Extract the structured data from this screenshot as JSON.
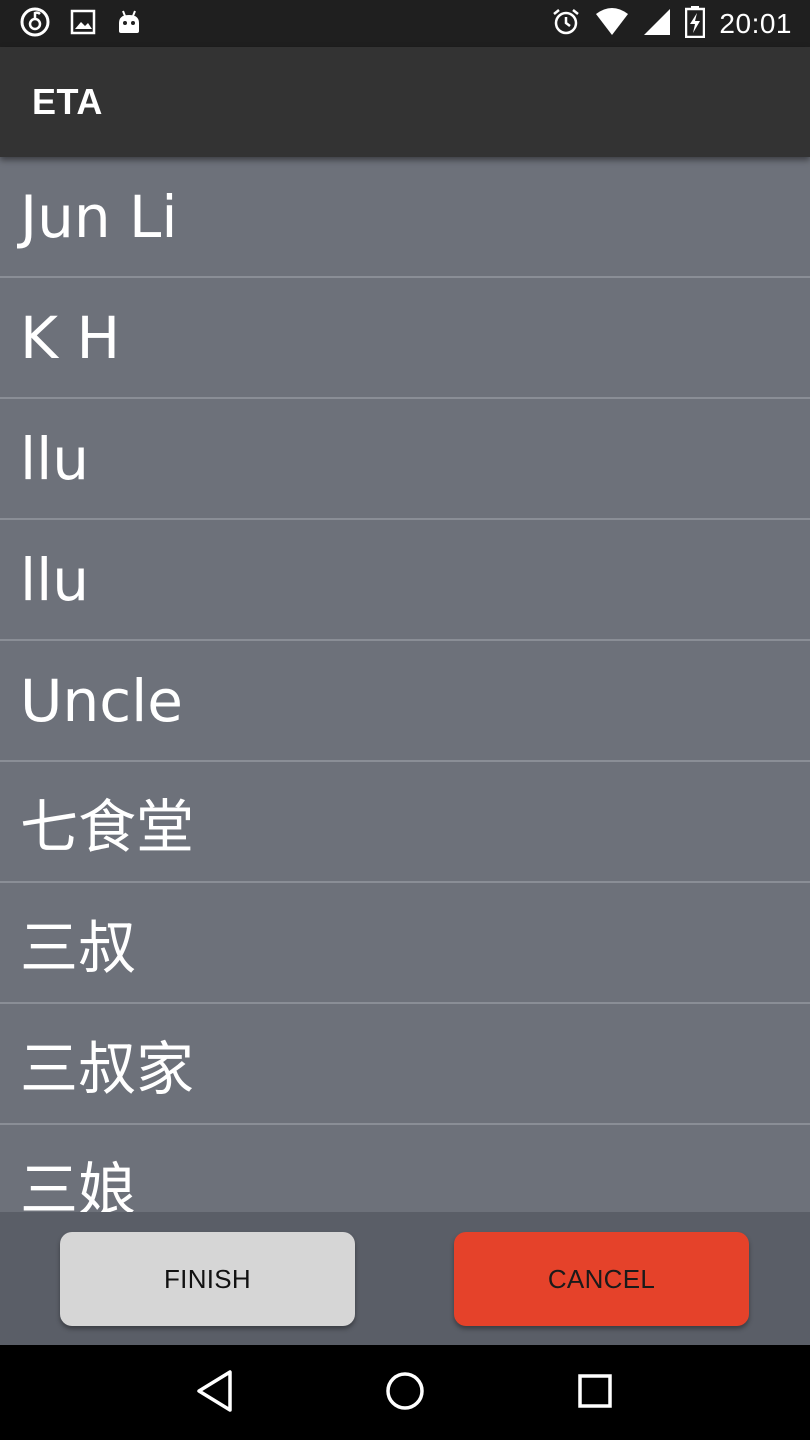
{
  "status_bar": {
    "time": "20:01",
    "icons_left": [
      "netease-music-icon",
      "image-icon",
      "android-robot-icon"
    ],
    "icons_right": [
      "alarm-icon",
      "wifi-icon",
      "cell-signal-icon",
      "battery-charging-icon"
    ]
  },
  "app_bar": {
    "title": "ETA"
  },
  "contacts": [
    {
      "name": "Jun Li"
    },
    {
      "name": "K H"
    },
    {
      "name": "llu"
    },
    {
      "name": "llu"
    },
    {
      "name": "Uncle"
    },
    {
      "name": "七食堂"
    },
    {
      "name": "三叔"
    },
    {
      "name": "三叔家"
    },
    {
      "name": "三娘"
    }
  ],
  "buttons": {
    "finish_label": "FINISH",
    "cancel_label": "CANCEL"
  },
  "nav_bar": {
    "icons": [
      "back-icon",
      "home-icon",
      "recents-icon"
    ]
  },
  "colors": {
    "status_bar": "#1f1f1f",
    "app_bar": "#333333",
    "list_bg": "#6d717a",
    "cancel_button": "#e5422a",
    "finish_button": "#d6d6d6"
  }
}
